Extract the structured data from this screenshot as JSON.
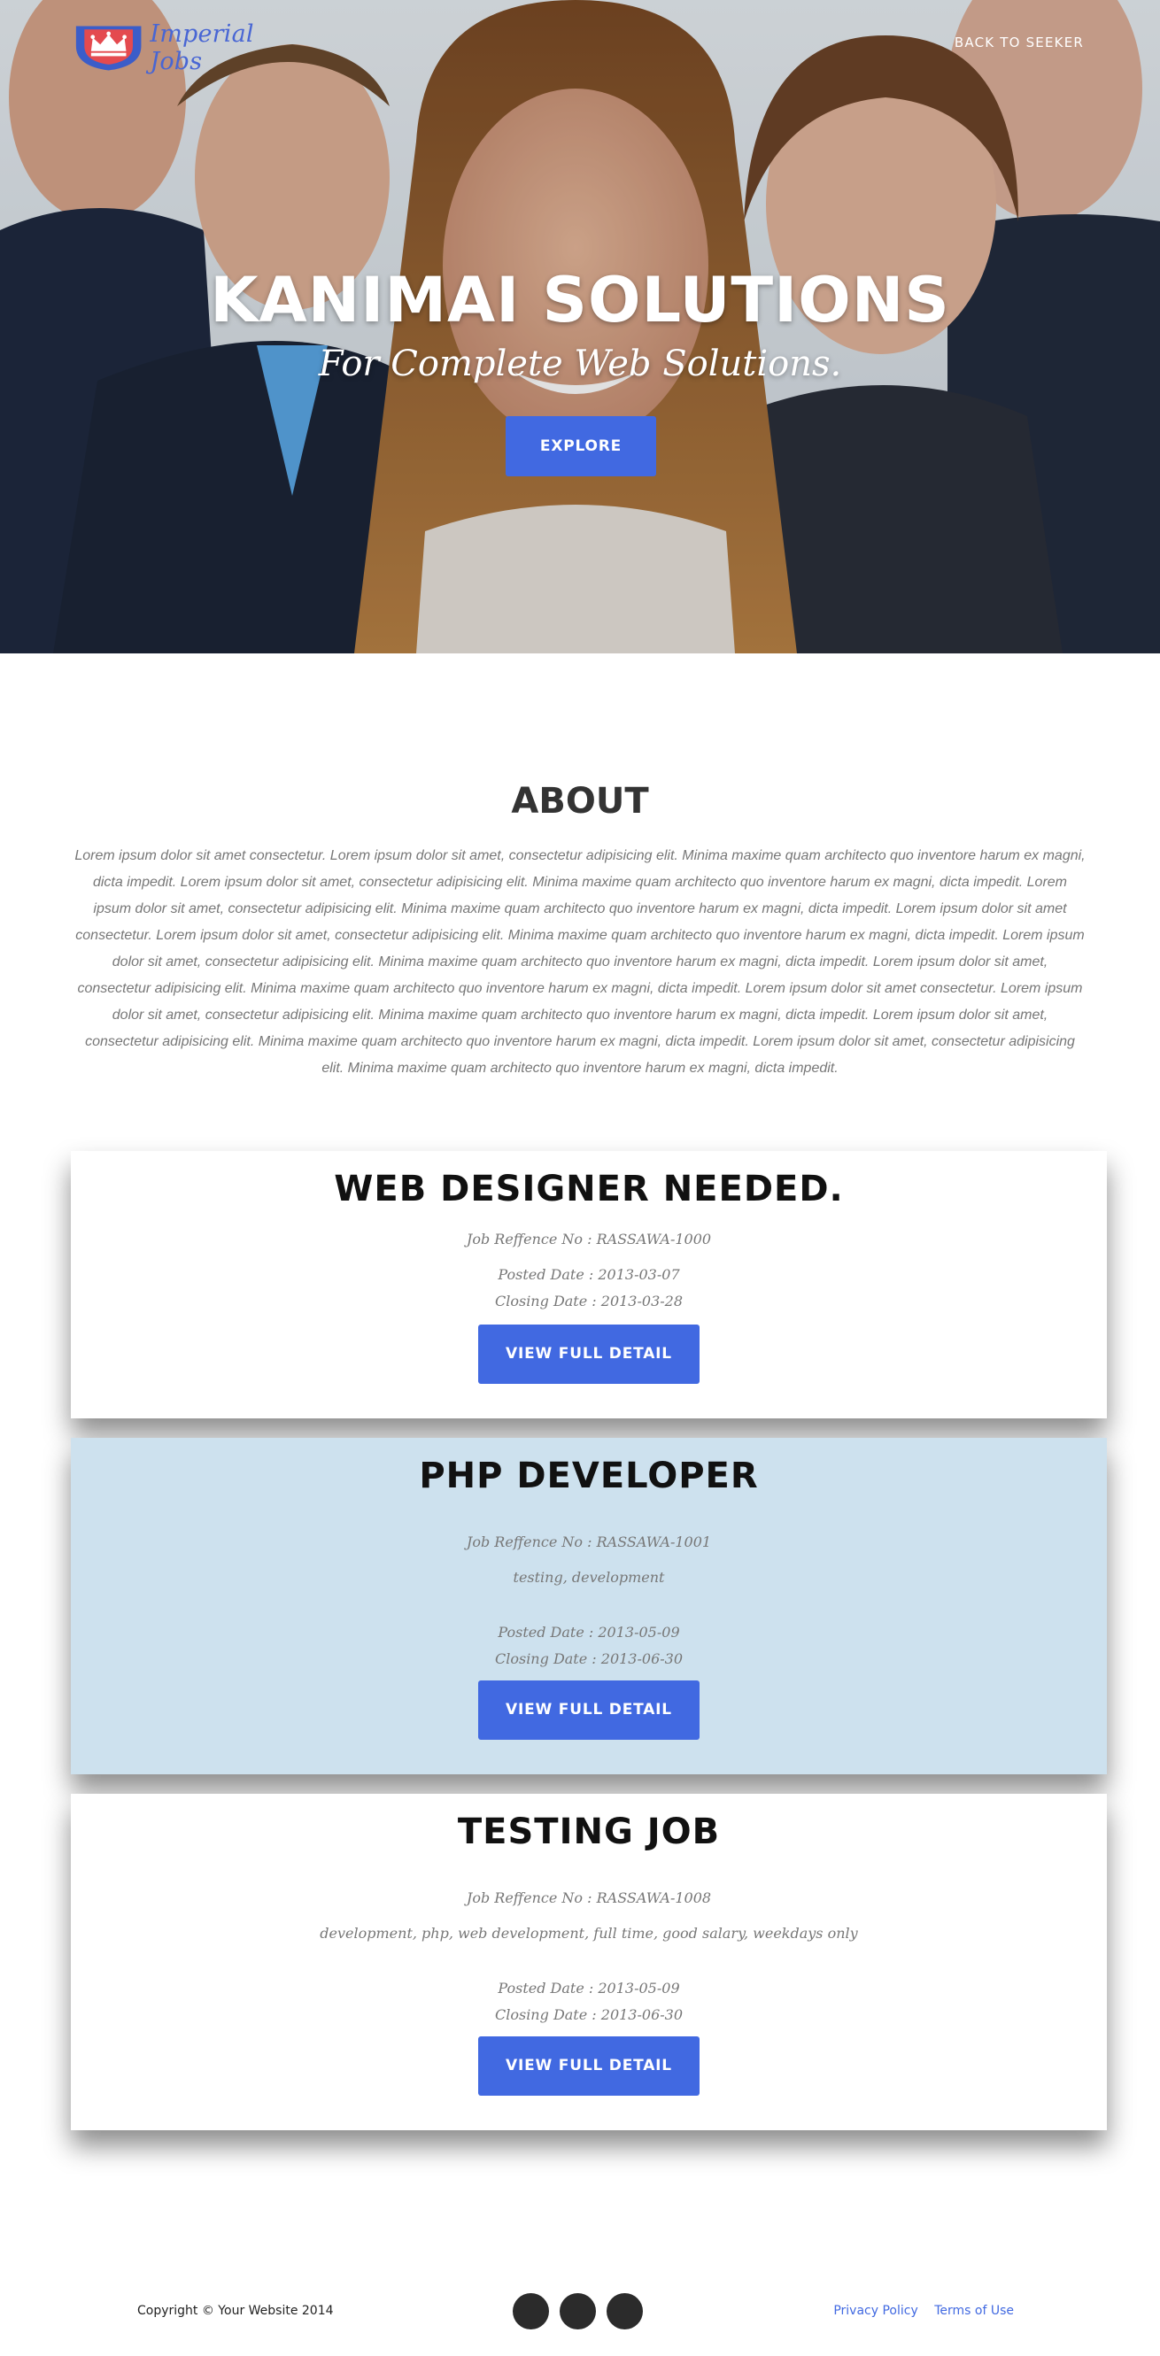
{
  "header": {
    "brand": "Imperial Jobs",
    "back_link": "BACK TO SEEKER"
  },
  "hero": {
    "title": "KANIMAI SOLUTIONS",
    "subtitle": "For Complete Web Solutions.",
    "explore_label": "EXPLORE"
  },
  "about": {
    "title": "ABOUT",
    "text": "Lorem ipsum dolor sit amet consectetur. Lorem ipsum dolor sit amet, consectetur adipisicing elit. Minima maxime quam architecto quo inventore harum ex magni, dicta impedit. Lorem ipsum dolor sit amet, consectetur adipisicing elit. Minima maxime quam architecto quo inventore harum ex magni, dicta impedit. Lorem ipsum dolor sit amet, consectetur adipisicing elit. Minima maxime quam architecto quo inventore harum ex magni, dicta impedit. Lorem ipsum dolor sit amet consectetur. Lorem ipsum dolor sit amet, consectetur adipisicing elit. Minima maxime quam architecto quo inventore harum ex magni, dicta impedit. Lorem ipsum dolor sit amet, consectetur adipisicing elit. Minima maxime quam architecto quo inventore harum ex magni, dicta impedit. Lorem ipsum dolor sit amet, consectetur adipisicing elit. Minima maxime quam architecto quo inventore harum ex magni, dicta impedit. Lorem ipsum dolor sit amet consectetur. Lorem ipsum dolor sit amet, consectetur adipisicing elit. Minima maxime quam architecto quo inventore harum ex magni, dicta impedit. Lorem ipsum dolor sit amet, consectetur adipisicing elit. Minima maxime quam architecto quo inventore harum ex magni, dicta impedit. Lorem ipsum dolor sit amet, consectetur adipisicing elit. Minima maxime quam architecto quo inventore harum ex magni, dicta impedit."
  },
  "jobs": [
    {
      "title": "WEB DESIGNER NEEDED.",
      "ref": "Job Reffence No : RASSAWA-1000",
      "tags": "",
      "posted": "Posted Date : 2013-03-07",
      "closing": "Closing Date : 2013-03-28",
      "button": "VIEW FULL DETAIL"
    },
    {
      "title": "PHP DEVELOPER",
      "ref": "Job Reffence No : RASSAWA-1001",
      "tags": "testing, development",
      "posted": "Posted Date : 2013-05-09",
      "closing": "Closing Date : 2013-06-30",
      "button": "VIEW FULL DETAIL"
    },
    {
      "title": "TESTING JOB",
      "ref": "Job Reffence No : RASSAWA-1008",
      "tags": "development, php, web development, full time, good salary, weekdays only",
      "posted": "Posted Date : 2013-05-09",
      "closing": "Closing Date : 2013-06-30",
      "button": "VIEW FULL DETAIL"
    }
  ],
  "footer": {
    "copyright": "Copyright © Your Website 2014",
    "privacy": "Privacy Policy",
    "terms": "Terms of Use"
  },
  "colors": {
    "accent": "#4169e1",
    "card_alt": "#cde1ee"
  }
}
